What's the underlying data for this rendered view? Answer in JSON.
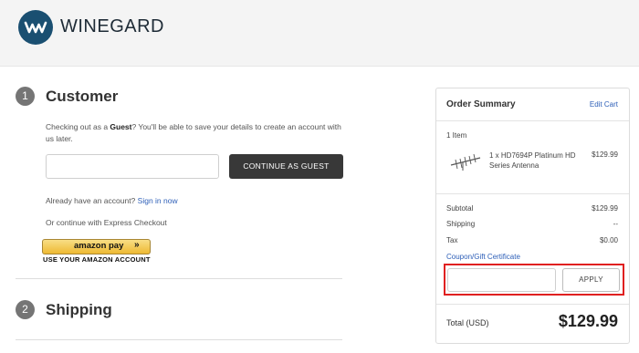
{
  "header": {
    "brand": "WINEGARD",
    "background": "#f4f4f4",
    "logo_color": "#1a4f71"
  },
  "steps": [
    {
      "number": "1",
      "title": "Customer"
    },
    {
      "number": "2",
      "title": "Shipping"
    }
  ],
  "customer": {
    "guest_prefix": "Checking out as a ",
    "guest_bold": "Guest",
    "guest_suffix": "? You'll be able to save your details to create an account with us later.",
    "email_value": "",
    "continue_label": "CONTINUE AS GUEST",
    "account_prompt": "Already have an account?",
    "signin_label": "Sign in now",
    "express_label": "Or continue with Express Checkout",
    "amazon_label": "amazon pay",
    "amazon_chevron": "»",
    "amazon_sub": "USE YOUR AMAZON ACCOUNT"
  },
  "summary": {
    "title": "Order Summary",
    "edit_label": "Edit Cart",
    "item_count": "1 Item",
    "items": [
      {
        "name": "1 x HD7694P Platinum HD Series Antenna",
        "price": "$129.99",
        "icon": "antenna-icon"
      }
    ],
    "rows": [
      {
        "label": "Subtotal",
        "value": "$129.99"
      },
      {
        "label": "Shipping",
        "value": "--"
      },
      {
        "label": "Tax",
        "value": "$0.00"
      }
    ],
    "coupon_label": "Coupon/Gift Certificate",
    "coupon_value": "",
    "apply_label": "APPLY",
    "highlight_color": "#e02020",
    "total_label": "Total (USD)",
    "total_value": "$129.99"
  },
  "colors": {
    "link": "#2f60b8",
    "dark_button": "#383838",
    "step_badge": "#757575"
  }
}
